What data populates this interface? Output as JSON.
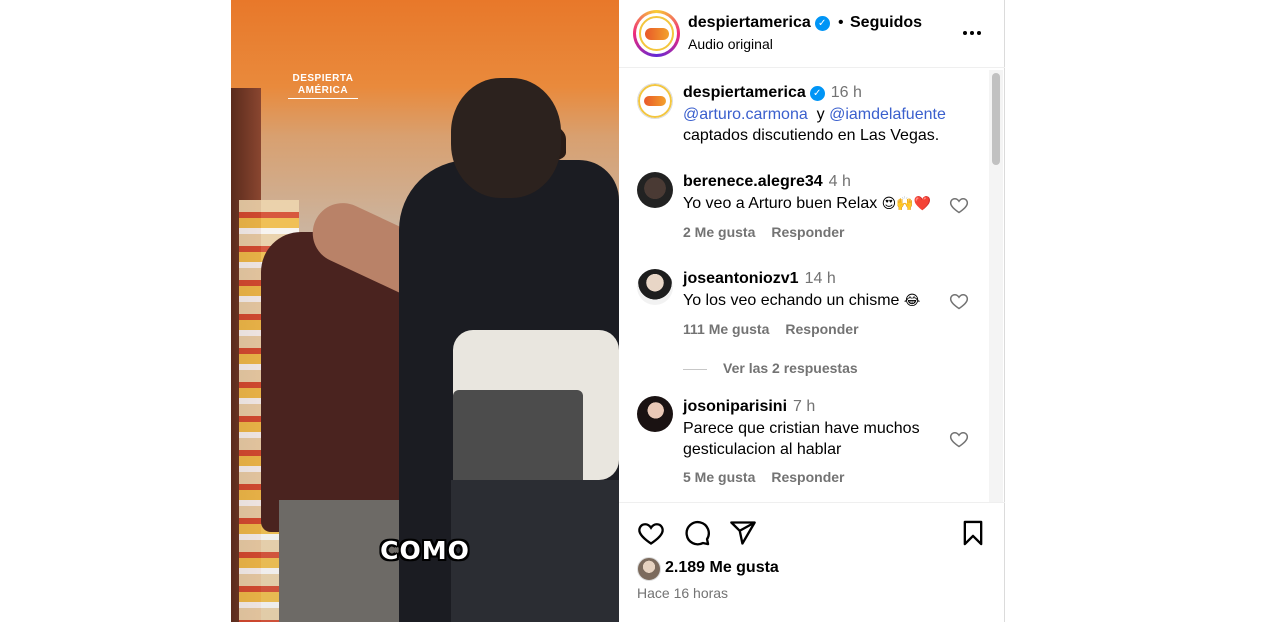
{
  "video": {
    "brand_line1": "DESPIERTA",
    "brand_line2": "AMÉRICA",
    "caption": "COMO"
  },
  "header": {
    "username": "despiertamerica",
    "separator": "•",
    "follow_status": "Seguidos",
    "audio": "Audio original",
    "verified_icon": "check-badge-icon"
  },
  "post": {
    "username": "despiertamerica",
    "time": "16 h",
    "mention1": "@arturo.carmona",
    "connector": "y",
    "mention2": "@iamdelafuente",
    "text": "captados discutiendo en Las Vegas."
  },
  "comments": [
    {
      "username": "berenece.alegre34",
      "time": "4 h",
      "text": "Yo veo a Arturo buen Relax",
      "emoji": "😍🙌❤️",
      "likes": "2 Me gusta",
      "reply": "Responder"
    },
    {
      "username": "joseantoniozv1",
      "time": "14 h",
      "text": "Yo los veo echando un chisme",
      "emoji": "😂",
      "likes": "111 Me gusta",
      "reply": "Responder",
      "view_replies": "Ver las 2 respuestas"
    },
    {
      "username": "josoniparisini",
      "time": "7 h",
      "text_line1": "Parece que cristian have muchos",
      "text_line2": "gesticulacion al hablar",
      "likes": "5 Me gusta",
      "reply": "Responder"
    }
  ],
  "footer": {
    "likes": "2.189 Me gusta",
    "posted": "Hace 16 horas"
  },
  "colors": {
    "mention": "#3a5fcd",
    "verified": "#0095f6",
    "muted": "#737373"
  }
}
